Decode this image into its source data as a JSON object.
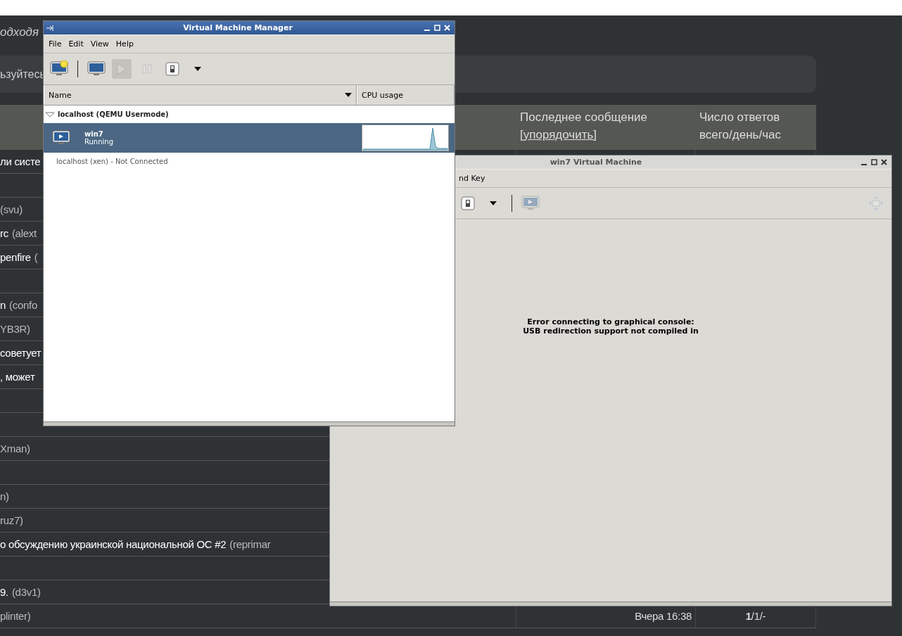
{
  "background_page": {
    "subtitle": "одходя",
    "notice": "ьзуйтесь",
    "table": {
      "columns": [
        {
          "title": "Последнее сообщение",
          "sort_link": "[упорядочить]"
        },
        {
          "title": "Число ответов всего/день/час"
        }
      ],
      "rows": [
        {
          "title": "ли систе"
        },
        {},
        {
          "author": "(svu)"
        },
        {
          "title": "rc",
          "author": "(alext"
        },
        {
          "title": "penfire",
          "author": "("
        },
        {},
        {
          "title": "n",
          "author": "(confo"
        },
        {
          "author": "YB3R)"
        },
        {
          "title": "советует"
        },
        {
          "title": ", может"
        },
        {},
        {},
        {
          "author": "Xman)"
        },
        {},
        {
          "author": "n)"
        },
        {
          "author": "ruz7)"
        },
        {
          "title": "о обсуждению украинской национальной ОС #2",
          "author": "(reprimar"
        },
        {},
        {
          "title": "9.",
          "author": "(d3v1)"
        },
        {
          "author": "plinter)",
          "last_message": "Вчера 16:38",
          "replies": "**1**/1/-"
        }
      ]
    }
  },
  "manager_window": {
    "title": "Virtual Machine Manager",
    "menu": [
      "File",
      "Edit",
      "View",
      "Help"
    ],
    "toolbar": [
      {
        "kind": "new",
        "disabled": false,
        "selected": false
      },
      {
        "kind": "separator"
      },
      {
        "kind": "open",
        "disabled": false,
        "selected": false
      },
      {
        "kind": "run",
        "disabled": true,
        "selected": true
      },
      {
        "kind": "pause",
        "disabled": true,
        "selected": false
      },
      {
        "kind": "shutdown",
        "disabled": false,
        "selected": false
      },
      {
        "kind": "dropdown",
        "disabled": false,
        "selected": false
      }
    ],
    "columns": [
      "Name",
      "CPU usage"
    ],
    "connections": [
      {
        "name": "localhost (QEMU Usermode)",
        "expanded": true,
        "children": [
          {
            "name": "win7",
            "status": "Running",
            "selected": true
          }
        ]
      },
      {
        "name": "localhost (xen) - Not Connected",
        "expanded": false
      }
    ]
  },
  "console_window": {
    "title": "win7 Virtual Machine",
    "menu": [
      "nd Key"
    ],
    "toolbar": [
      {
        "kind": "shutdown",
        "disabled": false
      },
      {
        "kind": "dropdown",
        "disabled": false
      },
      {
        "kind": "separator"
      },
      {
        "kind": "console",
        "disabled": true
      },
      {
        "kind": "spacer"
      },
      {
        "kind": "fullscreen",
        "disabled": true
      }
    ],
    "message": [
      "Error connecting to graphical console:",
      "USB redirection support not compiled in"
    ]
  }
}
